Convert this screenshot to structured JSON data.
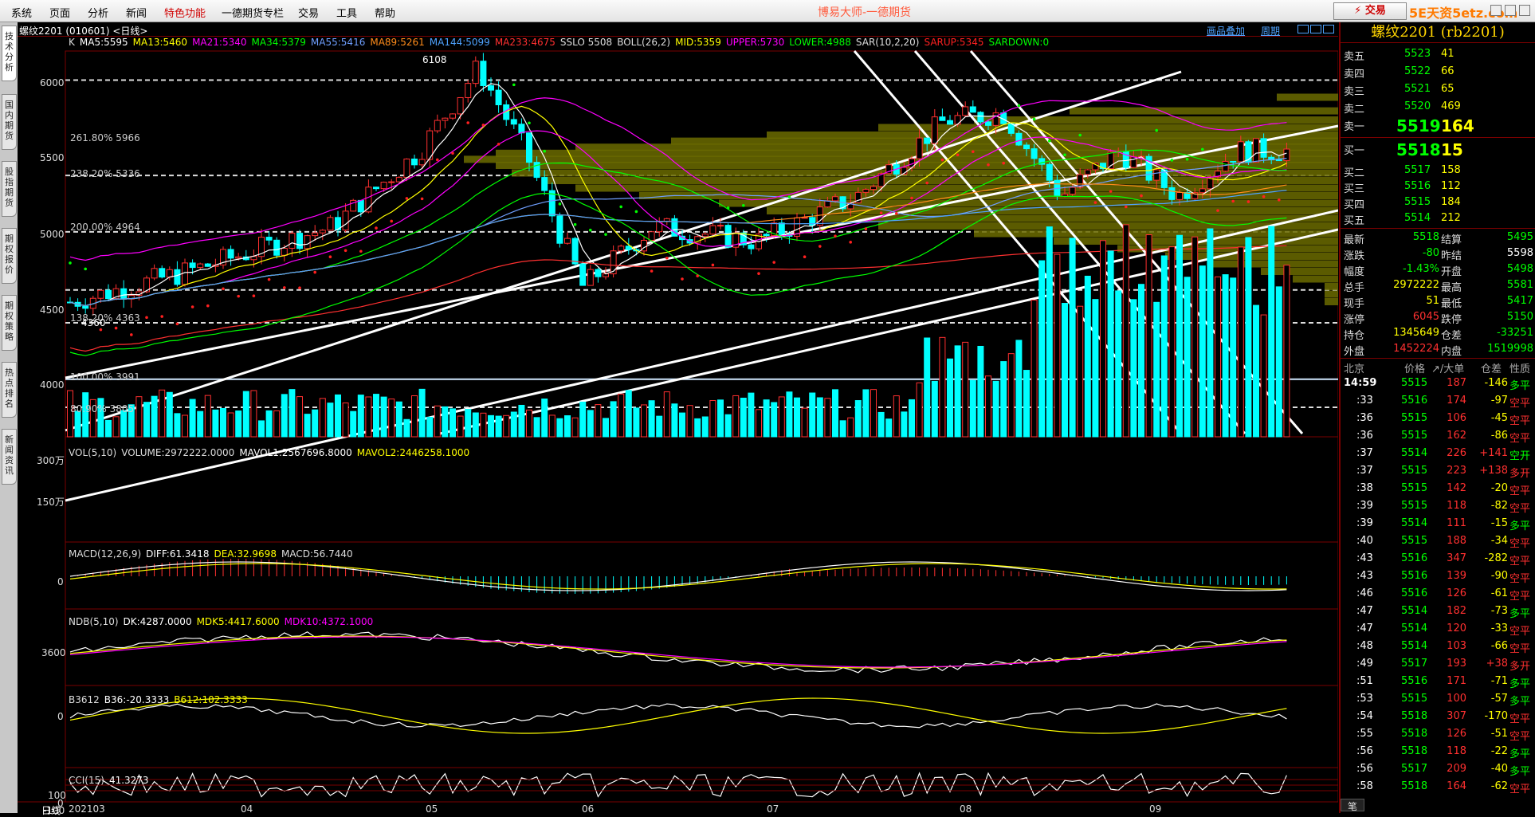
{
  "menu": {
    "items": [
      "系统",
      "页面",
      "分析",
      "新闻",
      "特色功能",
      "一德期货专栏",
      "交易",
      "工具",
      "帮助"
    ],
    "app_title": "博易大师-一德期货",
    "trade_btn": "⚡ 交易",
    "watermark": "5E天资5etz.com"
  },
  "sidebar": {
    "tabs": [
      "技术分析",
      "国内期货",
      "股指期货",
      "期权报价",
      "期权策略",
      "热点排名",
      "新闻资讯"
    ]
  },
  "chart": {
    "symbol_label": "螺纹2201 (010601) <日线>",
    "top_links": [
      "画品叠加",
      "周期"
    ],
    "kline_legend": [
      {
        "t": "K",
        "c": "#dddddd"
      },
      {
        "t": "MA5:5595",
        "c": "#ffffff"
      },
      {
        "t": "MA13:5460",
        "c": "#ffff00"
      },
      {
        "t": "MA21:5340",
        "c": "#ff00ff"
      },
      {
        "t": "MA34:5379",
        "c": "#00ff00"
      },
      {
        "t": "MA55:5416",
        "c": "#6f9fff"
      },
      {
        "t": "MA89:5261",
        "c": "#ff8c1a"
      },
      {
        "t": "MA144:5099",
        "c": "#4fa3ff"
      },
      {
        "t": "MA233:4675",
        "c": "#ff3030"
      },
      {
        "t": "SSLO 5508",
        "c": "#dddddd"
      },
      {
        "t": "BOLL(26,2)",
        "c": "#dddddd"
      },
      {
        "t": "MID:5359",
        "c": "#ffff00"
      },
      {
        "t": "UPPER:5730",
        "c": "#ff00ff"
      },
      {
        "t": "LOWER:4988",
        "c": "#00ff00"
      },
      {
        "t": "SAR(10,2,20)",
        "c": "#dddddd"
      },
      {
        "t": "SARUP:5345",
        "c": "#ff2020"
      },
      {
        "t": "SARDOWN:0",
        "c": "#00ff00"
      }
    ],
    "price_ticks": [
      "6000",
      "5500",
      "5000",
      "4500",
      "4000"
    ],
    "fib_levels": [
      "261.80% 5966",
      "238.20% 5336",
      "200.00% 4964",
      "138.20% 4363",
      "100.00% 3991",
      "80.90% 3805"
    ],
    "high_marker": "6108",
    "low_marker": "4360",
    "vol_legend": [
      {
        "t": "VOL(5,10)",
        "c": "#dddddd"
      },
      {
        "t": "VOLUME:2972222.0000",
        "c": "#dddddd"
      },
      {
        "t": "MAVOL1:2567696.8000",
        "c": "#ffffff"
      },
      {
        "t": "MAVOL2:2446258.1000",
        "c": "#ffff00"
      }
    ],
    "vol_ticks": [
      "300万",
      "150万"
    ],
    "macd_legend": [
      {
        "t": "MACD(12,26,9)",
        "c": "#dddddd"
      },
      {
        "t": "DIFF:61.3418",
        "c": "#ffffff"
      },
      {
        "t": "DEA:32.9698",
        "c": "#ffff00"
      },
      {
        "t": "MACD:56.7440",
        "c": "#dddddd"
      }
    ],
    "macd_ticks": [
      "0"
    ],
    "ndb_legend": [
      {
        "t": "NDB(5,10)",
        "c": "#dddddd"
      },
      {
        "t": "DK:4287.0000",
        "c": "#ffffff"
      },
      {
        "t": "MDK5:4417.6000",
        "c": "#ffff00"
      },
      {
        "t": "MDK10:4372.1000",
        "c": "#ff00ff"
      }
    ],
    "ndb_ticks": [
      "3600"
    ],
    "b36_legend": [
      {
        "t": "B3612",
        "c": "#dddddd"
      },
      {
        "t": "B36:-20.3333",
        "c": "#ffffff"
      },
      {
        "t": "B612:102.3333",
        "c": "#ffff00"
      }
    ],
    "b36_ticks": [
      "0"
    ],
    "cci_legend": [
      {
        "t": "CCI(15)",
        "c": "#dddddd"
      },
      {
        "t": "41.3273",
        "c": "#ffffff"
      }
    ],
    "cci_ticks": [
      "100",
      "0",
      "-100"
    ],
    "period_label": "日线",
    "date_labels": [
      "202103",
      "04",
      "05",
      "06",
      "07",
      "08",
      "09"
    ]
  },
  "quote": {
    "title": "螺纹2201 (rb2201)",
    "asks": [
      {
        "l": "卖五",
        "p": "5523",
        "v": "41"
      },
      {
        "l": "卖四",
        "p": "5522",
        "v": "66"
      },
      {
        "l": "卖三",
        "p": "5521",
        "v": "65"
      },
      {
        "l": "卖二",
        "p": "5520",
        "v": "469"
      },
      {
        "l": "卖一",
        "p": "5519",
        "v": "164"
      }
    ],
    "bids": [
      {
        "l": "买一",
        "p": "5518",
        "v": "15"
      },
      {
        "l": "买二",
        "p": "5517",
        "v": "158"
      },
      {
        "l": "买三",
        "p": "5516",
        "v": "112"
      },
      {
        "l": "买四",
        "p": "5515",
        "v": "184"
      },
      {
        "l": "买五",
        "p": "5514",
        "v": "212"
      }
    ],
    "stats": [
      {
        "l1": "最新",
        "v1": "5518",
        "c1": "#00ff00",
        "l2": "结算",
        "v2": "5495",
        "c2": "#00ff00"
      },
      {
        "l1": "涨跌",
        "v1": "-80",
        "c1": "#00ff00",
        "l2": "昨结",
        "v2": "5598",
        "c2": "#ffffff"
      },
      {
        "l1": "幅度",
        "v1": "-1.43%",
        "c1": "#00ff00",
        "l2": "开盘",
        "v2": "5498",
        "c2": "#00ff00"
      },
      {
        "l1": "总手",
        "v1": "2972222",
        "c1": "#ffff00",
        "l2": "最高",
        "v2": "5581",
        "c2": "#00ff00"
      },
      {
        "l1": "现手",
        "v1": "51",
        "c1": "#ffff00",
        "l2": "最低",
        "v2": "5417",
        "c2": "#00ff00"
      },
      {
        "l1": "涨停",
        "v1": "6045",
        "c1": "#ff3030",
        "l2": "跌停",
        "v2": "5150",
        "c2": "#00ff00"
      },
      {
        "l1": "持仓",
        "v1": "1345649",
        "c1": "#ffff00",
        "l2": "仓差",
        "v2": "-33251",
        "c2": "#00ff00"
      },
      {
        "l1": "外盘",
        "v1": "1452224",
        "c1": "#ff3030",
        "l2": "内盘",
        "v2": "1519998",
        "c2": "#00ff00"
      }
    ],
    "tick_header": [
      "北京",
      "价格",
      "↗/大单",
      "仓差",
      "性质"
    ],
    "ticks": [
      {
        "t": "14:59",
        "p": "5515",
        "v": "187",
        "d": "-146",
        "n": "多平"
      },
      {
        "t": ":33",
        "p": "5516",
        "v": "174",
        "d": "-97",
        "n": "空平"
      },
      {
        "t": ":36",
        "p": "5515",
        "v": "106",
        "d": "-45",
        "n": "空平"
      },
      {
        "t": ":36",
        "p": "5515",
        "v": "162",
        "d": "-86",
        "n": "空平"
      },
      {
        "t": ":37",
        "p": "5514",
        "v": "226",
        "d": "+141",
        "n": "空开"
      },
      {
        "t": ":37",
        "p": "5515",
        "v": "223",
        "d": "+138",
        "n": "多开"
      },
      {
        "t": ":38",
        "p": "5515",
        "v": "142",
        "d": "-20",
        "n": "空平"
      },
      {
        "t": ":39",
        "p": "5515",
        "v": "118",
        "d": "-82",
        "n": "空平"
      },
      {
        "t": ":39",
        "p": "5514",
        "v": "111",
        "d": "-15",
        "n": "多平"
      },
      {
        "t": ":40",
        "p": "5515",
        "v": "188",
        "d": "-34",
        "n": "空平"
      },
      {
        "t": ":43",
        "p": "5516",
        "v": "347",
        "d": "-282",
        "n": "空平"
      },
      {
        "t": ":43",
        "p": "5516",
        "v": "139",
        "d": "-90",
        "n": "空平"
      },
      {
        "t": ":46",
        "p": "5516",
        "v": "126",
        "d": "-61",
        "n": "空平"
      },
      {
        "t": ":47",
        "p": "5514",
        "v": "182",
        "d": "-73",
        "n": "多平"
      },
      {
        "t": ":47",
        "p": "5514",
        "v": "120",
        "d": "-33",
        "n": "空平"
      },
      {
        "t": ":48",
        "p": "5514",
        "v": "103",
        "d": "-66",
        "n": "空平"
      },
      {
        "t": ":49",
        "p": "5517",
        "v": "193",
        "d": "+38",
        "n": "多开"
      },
      {
        "t": ":51",
        "p": "5516",
        "v": "171",
        "d": "-71",
        "n": "多平"
      },
      {
        "t": ":53",
        "p": "5515",
        "v": "100",
        "d": "-57",
        "n": "多平"
      },
      {
        "t": ":54",
        "p": "5518",
        "v": "307",
        "d": "-170",
        "n": "空平"
      },
      {
        "t": ":55",
        "p": "5518",
        "v": "126",
        "d": "-51",
        "n": "空平"
      },
      {
        "t": ":56",
        "p": "5518",
        "v": "118",
        "d": "-22",
        "n": "多平"
      },
      {
        "t": ":56",
        "p": "5517",
        "v": "209",
        "d": "-40",
        "n": "多平"
      },
      {
        "t": ":58",
        "p": "5518",
        "v": "164",
        "d": "-62",
        "n": "空平"
      }
    ],
    "bottom_tab": "笔"
  }
}
